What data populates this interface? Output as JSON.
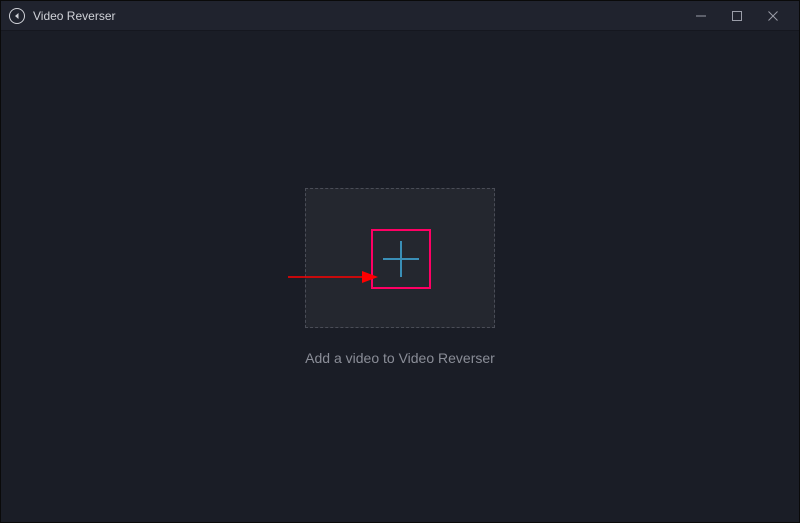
{
  "titlebar": {
    "app_name": "Video Reverser"
  },
  "main": {
    "instruction": "Add a video to Video Reverser"
  },
  "icons": {
    "app": "reverse-icon",
    "plus": "plus-icon",
    "minimize": "minimize-icon",
    "maximize": "maximize-icon",
    "close": "close-icon"
  },
  "annotation": {
    "arrow_color": "#ff0000",
    "highlight_color": "#ff0064"
  }
}
